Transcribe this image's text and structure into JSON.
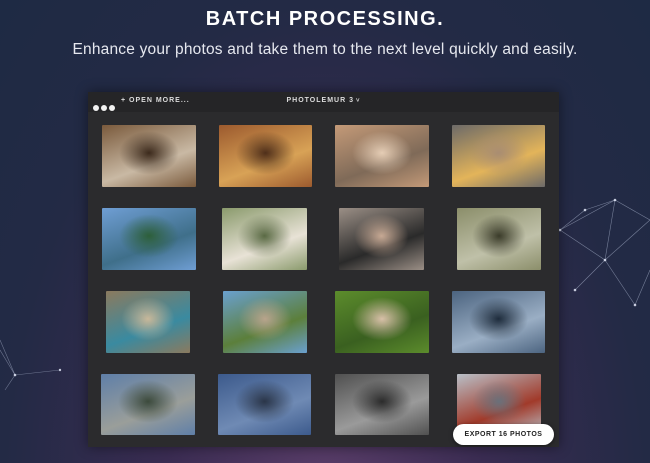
{
  "hero": {
    "title": "BATCH PROCESSING.",
    "subtitle": "Enhance your photos and take them to the next level quickly and easily."
  },
  "window": {
    "open_more_label": "+ OPEN MORE...",
    "app_title": "PHOTOLEMUR 3",
    "app_title_caret": "˅",
    "export_label": "EXPORT 16 PHOTOS"
  },
  "photos": [
    {
      "subject": "woman in doorway",
      "colors": [
        "#7a5a3c",
        "#c9b9a4",
        "#3c2a1c"
      ]
    },
    {
      "subject": "woman with bicycle by wooden wall",
      "colors": [
        "#9c5a2e",
        "#d8a256",
        "#4f2f1a"
      ]
    },
    {
      "subject": "woman with hand in hair",
      "colors": [
        "#c49a78",
        "#7f6a58",
        "#e5cdb5"
      ]
    },
    {
      "subject": "woman with flower crown",
      "colors": [
        "#6d6a68",
        "#e3b45a",
        "#a98d72"
      ]
    },
    {
      "subject": "mountain lake landscape",
      "colors": [
        "#6f9ed4",
        "#3f6f8a",
        "#2d5f3a"
      ]
    },
    {
      "subject": "woman with sunglasses",
      "colors": [
        "#8a9a6c",
        "#e8e2d6",
        "#5a6a44"
      ]
    },
    {
      "subject": "woman with glasses",
      "colors": [
        "#9b8f86",
        "#2a2a2a",
        "#c7a994"
      ]
    },
    {
      "subject": "woman by wall and plants",
      "colors": [
        "#8b8e6a",
        "#bfc0a8",
        "#3b3c2a"
      ]
    },
    {
      "subject": "child on road",
      "colors": [
        "#8b7a5e",
        "#3a8aa0",
        "#c8b89a"
      ]
    },
    {
      "subject": "couple under palm trees",
      "colors": [
        "#6aa0cf",
        "#5c7f3b",
        "#b8a48c"
      ]
    },
    {
      "subject": "woman in green foliage",
      "colors": [
        "#5c8c2c",
        "#3a6020",
        "#d8c0a8"
      ]
    },
    {
      "subject": "mountain lake at dusk",
      "colors": [
        "#4c6480",
        "#9aaec4",
        "#1e2c3c"
      ]
    },
    {
      "subject": "car on open road",
      "colors": [
        "#5f7fa8",
        "#9a9e9a",
        "#3c4a3c"
      ]
    },
    {
      "subject": "city skyline at dusk",
      "colors": [
        "#3c5a8c",
        "#6f8ab4",
        "#2a3548"
      ]
    },
    {
      "subject": "road through dark hills",
      "colors": [
        "#505050",
        "#9a9a9a",
        "#2b2b2b"
      ]
    },
    {
      "subject": "golden gate bridge",
      "colors": [
        "#b9c0c8",
        "#a13a2a",
        "#6a707a"
      ]
    }
  ]
}
